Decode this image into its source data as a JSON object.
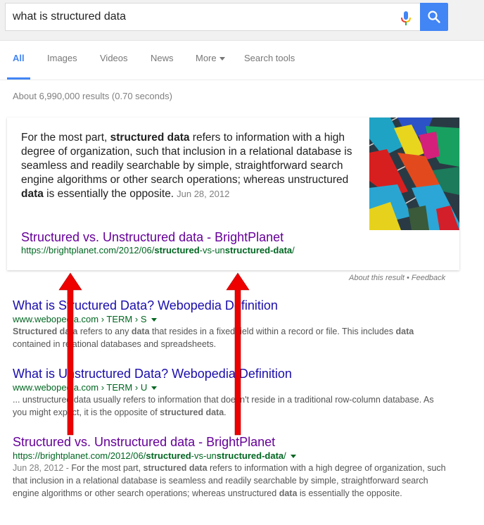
{
  "search": {
    "query": "what is structured data",
    "mic_icon": "microphone-icon",
    "search_icon": "magnifier-icon",
    "colors": {
      "button": "#4285f4"
    }
  },
  "tabs": [
    {
      "label": "All",
      "active": true
    },
    {
      "label": "Images",
      "active": false
    },
    {
      "label": "Videos",
      "active": false
    },
    {
      "label": "News",
      "active": false
    },
    {
      "label": "More",
      "active": false,
      "has_caret": true
    },
    {
      "label": "Search tools",
      "active": false
    }
  ],
  "stats": "About 6,990,000 results (0.70 seconds)",
  "featured": {
    "snippet": [
      {
        "t": "For the most part, ",
        "b": false
      },
      {
        "t": "structured data",
        "b": true
      },
      {
        "t": " refers to information with a high degree of organization, such that inclusion in a relational database is seamless and readily searchable by simple, straightforward search engine algorithms or other search operations; whereas unstructured ",
        "b": false
      },
      {
        "t": "data",
        "b": true
      },
      {
        "t": " is essentially the opposite.",
        "b": false
      }
    ],
    "date": "Jun 28, 2012",
    "title": "Structured vs. Unstructured data - BrightPlanet",
    "url": [
      {
        "t": "https://brightplanet.com/2012/06/",
        "b": false
      },
      {
        "t": "structured",
        "b": true
      },
      {
        "t": "-vs-un",
        "b": false
      },
      {
        "t": "structured-data",
        "b": true
      },
      {
        "t": "/",
        "b": false
      }
    ],
    "image_alt": "colorful abstract arrows image",
    "about_label": "About this result",
    "separator": "•",
    "feedback_label": "Feedback"
  },
  "results": [
    {
      "title": "What is Structured Data? Webopedia Definition",
      "visited": false,
      "url": [
        {
          "t": "www.webopedia.com › TERM › S",
          "b": false
        }
      ],
      "snippet": [
        {
          "t": "Structured data",
          "b": true
        },
        {
          "t": " refers to any ",
          "b": false
        },
        {
          "t": "data",
          "b": true
        },
        {
          "t": " that resides in a fixed field within a record or file. This includes ",
          "b": false
        },
        {
          "t": "data",
          "b": true
        },
        {
          "t": " contained in relational databases and spreadsheets.",
          "b": false
        }
      ]
    },
    {
      "title": "What is Unstructured Data? Webopedia Definition",
      "visited": false,
      "url": [
        {
          "t": "www.webopedia.com › TERM › U",
          "b": false
        }
      ],
      "snippet": [
        {
          "t": "... unstructured ",
          "b": false
        },
        {
          "t": "data",
          "b": false
        },
        {
          "t": " usually refers to information that doesn't reside in a traditional row-column database. As you might expect, it is the opposite of ",
          "b": false
        },
        {
          "t": "structured data",
          "b": true
        },
        {
          "t": ".",
          "b": false
        }
      ]
    },
    {
      "title": "Structured vs. Unstructured data - BrightPlanet",
      "visited": true,
      "url": [
        {
          "t": "https://brightplanet.com/2012/06/",
          "b": false
        },
        {
          "t": "structured",
          "b": true
        },
        {
          "t": "-vs-un",
          "b": false
        },
        {
          "t": "structured-data",
          "b": true
        },
        {
          "t": "/",
          "b": false
        }
      ],
      "date": "Jun 28, 2012",
      "snippet": [
        {
          "t": "For the most part, ",
          "b": false
        },
        {
          "t": "structured data",
          "b": true
        },
        {
          "t": " refers to information with a high degree of organization, such that inclusion in a relational database is seamless and readily searchable by simple, straightforward search engine algorithms or other search operations; whereas unstructured ",
          "b": false
        },
        {
          "t": "data",
          "b": true
        },
        {
          "t": " is essentially the opposite.",
          "b": false
        }
      ]
    }
  ],
  "annotations": {
    "arrow_color": "#ee0000",
    "arrows": [
      "red-arrow-left",
      "red-arrow-right"
    ]
  }
}
